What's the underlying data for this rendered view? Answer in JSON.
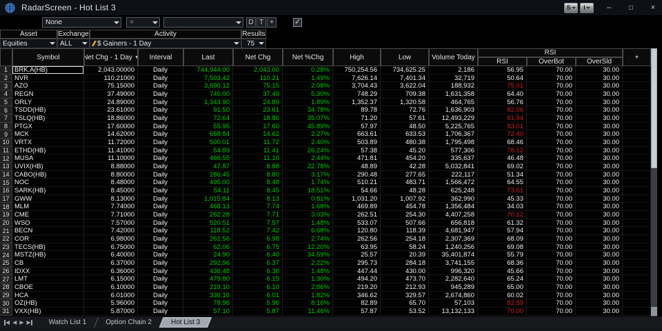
{
  "window": {
    "title": "RadarScreen - Hot List 3",
    "style_button": "S",
    "insert_button": "I",
    "minimize": "–",
    "maximize": "□",
    "close": "×"
  },
  "icons": {
    "check": "✓",
    "sort_desc": "▼",
    "nav_prev": "◀",
    "nav_next": "▶",
    "globe": "globe-icon",
    "dropdown_arrow": "triangle-down",
    "activity_flag": "yellow-flash"
  },
  "filter_bar": {
    "field_value": "None",
    "operator_value": "=",
    "criteria_value": "",
    "buttons": {
      "d": "D",
      "t": "T",
      "plus": "+"
    },
    "checkbox_checked": true
  },
  "criteria_bar": {
    "headers": {
      "asset": "Asset",
      "exchange": "Exchange",
      "activity": "Activity",
      "results": "Results"
    },
    "asset_value": "Equities",
    "exchange_value": "ALL",
    "activity_value": "$ Gainers -  1 Day",
    "results_value": "75"
  },
  "table": {
    "group_header": "RSI",
    "plus_header": "+",
    "columns": [
      "Symbol",
      "Net Chg - 1 Day",
      "Interval",
      "Last",
      "Net Chg",
      "Net %Chg",
      "High",
      "Low",
      "Volume Today",
      "RSI",
      "OverBot",
      "OverSld"
    ],
    "sort_column": "Net Chg - 1 Day",
    "rows": [
      {
        "num": "1",
        "symbol": "BRK.A(HB)",
        "net_chg_1day": "2,043.00000",
        "interval": "Daily",
        "last": "744,944.00",
        "net_chg": "2,043.00",
        "net_pct_chg": "0.28%",
        "high": "750,254.56",
        "low": "734,625.25",
        "volume": "2,186",
        "rsi": "56.95",
        "overbot": "70.00",
        "oversld": "30.00",
        "rsi_alert": false
      },
      {
        "num": "2",
        "symbol": "NVR",
        "net_chg_1day": "110.21000",
        "interval": "Daily",
        "last": "7,503.42",
        "net_chg": "110.21",
        "net_pct_chg": "1.49%",
        "high": "7,626.14",
        "low": "7,401.34",
        "volume": "32,719",
        "rsi": "50.64",
        "overbot": "70.00",
        "oversld": "30.00",
        "rsi_alert": false
      },
      {
        "num": "3",
        "symbol": "AZO",
        "net_chg_1day": "75.15000",
        "interval": "Daily",
        "last": "3,690.12",
        "net_chg": "75.15",
        "net_pct_chg": "2.08%",
        "high": "3,704.43",
        "low": "3,622.04",
        "volume": "188,932",
        "rsi": "75.01",
        "overbot": "70.00",
        "oversld": "30.00",
        "rsi_alert": true
      },
      {
        "num": "4",
        "symbol": "REGN",
        "net_chg_1day": "37.49000",
        "interval": "Daily",
        "last": "745.00",
        "net_chg": "37.49",
        "net_pct_chg": "5.30%",
        "high": "748.29",
        "low": "709.38",
        "volume": "1,631,358",
        "rsi": "64.40",
        "overbot": "70.00",
        "oversld": "30.00",
        "rsi_alert": false
      },
      {
        "num": "5",
        "symbol": "ORLY",
        "net_chg_1day": "24.89000",
        "interval": "Daily",
        "last": "1,343.90",
        "net_chg": "24.89",
        "net_pct_chg": "1.89%",
        "high": "1,352.37",
        "low": "1,320.58",
        "volume": "464,765",
        "rsi": "56.76",
        "overbot": "70.00",
        "oversld": "30.00",
        "rsi_alert": false
      },
      {
        "num": "6",
        "symbol": "TSDD(HB)",
        "net_chg_1day": "23.61000",
        "interval": "Daily",
        "last": "91.50",
        "net_chg": "23.61",
        "net_pct_chg": "34.78%",
        "high": "89.78",
        "low": "72.76",
        "volume": "1,636,903",
        "rsi": "82.06",
        "overbot": "70.00",
        "oversld": "30.00",
        "rsi_alert": true
      },
      {
        "num": "7",
        "symbol": "TSLQ(HB)",
        "net_chg_1day": "18.86000",
        "interval": "Daily",
        "last": "72.64",
        "net_chg": "18.86",
        "net_pct_chg": "35.07%",
        "high": "71.20",
        "low": "57.61",
        "volume": "12,493,229",
        "rsi": "81.94",
        "overbot": "70.00",
        "oversld": "30.00",
        "rsi_alert": true
      },
      {
        "num": "8",
        "symbol": "PTGX",
        "net_chg_1day": "17.60000",
        "interval": "Daily",
        "last": "55.95",
        "net_chg": "17.60",
        "net_pct_chg": "45.89%",
        "high": "57.97",
        "low": "48.50",
        "volume": "5,225,765",
        "rsi": "83.01",
        "overbot": "70.00",
        "oversld": "30.00",
        "rsi_alert": true
      },
      {
        "num": "9",
        "symbol": "MCK",
        "net_chg_1day": "14.62000",
        "interval": "Daily",
        "last": "658.84",
        "net_chg": "14.62",
        "net_pct_chg": "2.27%",
        "high": "663.61",
        "low": "633.53",
        "volume": "1,706,367",
        "rsi": "72.40",
        "overbot": "70.00",
        "oversld": "30.00",
        "rsi_alert": true
      },
      {
        "num": "10",
        "symbol": "VRTX",
        "net_chg_1day": "11.72000",
        "interval": "Daily",
        "last": "500.01",
        "net_chg": "11.72",
        "net_pct_chg": "2.40%",
        "high": "503.89",
        "low": "480.38",
        "volume": "1,795,498",
        "rsi": "68.46",
        "overbot": "70.00",
        "oversld": "30.00",
        "rsi_alert": false
      },
      {
        "num": "11",
        "symbol": "ETHD(HB)",
        "net_chg_1day": "11.41000",
        "interval": "Daily",
        "last": "54.89",
        "net_chg": "11.41",
        "net_pct_chg": "26.24%",
        "high": "57.38",
        "low": "45.20",
        "volume": "577,306",
        "rsi": "78.12",
        "overbot": "70.00",
        "oversld": "30.00",
        "rsi_alert": true
      },
      {
        "num": "12",
        "symbol": "MUSA",
        "net_chg_1day": "11.10000",
        "interval": "Daily",
        "last": "466.55",
        "net_chg": "11.10",
        "net_pct_chg": "2.44%",
        "high": "471.81",
        "low": "454.20",
        "volume": "335,637",
        "rsi": "46.48",
        "overbot": "70.00",
        "oversld": "30.00",
        "rsi_alert": false
      },
      {
        "num": "13",
        "symbol": "UVIX(HB)",
        "net_chg_1day": "8.88000",
        "interval": "Daily",
        "last": "47.87",
        "net_chg": "8.88",
        "net_pct_chg": "22.78%",
        "high": "48.89",
        "low": "42.28",
        "volume": "5,032,841",
        "rsi": "69.02",
        "overbot": "70.00",
        "oversld": "30.00",
        "rsi_alert": false
      },
      {
        "num": "14",
        "symbol": "CABO(HB)",
        "net_chg_1day": "8.80000",
        "interval": "Daily",
        "last": "286.45",
        "net_chg": "8.80",
        "net_pct_chg": "3.17%",
        "high": "290.48",
        "low": "277.65",
        "volume": "222,117",
        "rsi": "51.34",
        "overbot": "70.00",
        "oversld": "30.00",
        "rsi_alert": false
      },
      {
        "num": "15",
        "symbol": "NOC",
        "net_chg_1day": "8.48000",
        "interval": "Daily",
        "last": "495.00",
        "net_chg": "8.48",
        "net_pct_chg": "1.74%",
        "high": "510.21",
        "low": "483.71",
        "volume": "1,566,472",
        "rsi": "64.55",
        "overbot": "70.00",
        "oversld": "30.00",
        "rsi_alert": false
      },
      {
        "num": "16",
        "symbol": "SARK(HB)",
        "net_chg_1day": "8.45000",
        "interval": "Daily",
        "last": "54.11",
        "net_chg": "8.45",
        "net_pct_chg": "18.51%",
        "high": "54.66",
        "low": "48.28",
        "volume": "625,248",
        "rsi": "73.61",
        "overbot": "70.00",
        "oversld": "30.00",
        "rsi_alert": true
      },
      {
        "num": "17",
        "symbol": "GWW",
        "net_chg_1day": "8.13000",
        "interval": "Daily",
        "last": "1,015.84",
        "net_chg": "8.13",
        "net_pct_chg": "0.81%",
        "high": "1,031.20",
        "low": "1,007.92",
        "volume": "362,990",
        "rsi": "45.33",
        "overbot": "70.00",
        "oversld": "30.00",
        "rsi_alert": false
      },
      {
        "num": "18",
        "symbol": "MLM",
        "net_chg_1day": "7.74000",
        "interval": "Daily",
        "last": "468.13",
        "net_chg": "7.74",
        "net_pct_chg": "1.68%",
        "high": "469.89",
        "low": "454.78",
        "volume": "1,356,484",
        "rsi": "34.03",
        "overbot": "70.00",
        "oversld": "30.00",
        "rsi_alert": false
      },
      {
        "num": "19",
        "symbol": "CME",
        "net_chg_1day": "7.71000",
        "interval": "Daily",
        "last": "262.28",
        "net_chg": "7.71",
        "net_pct_chg": "3.03%",
        "high": "262.51",
        "low": "254.30",
        "volume": "4,407,258",
        "rsi": "70.12",
        "overbot": "70.00",
        "oversld": "30.00",
        "rsi_alert": true
      },
      {
        "num": "20",
        "symbol": "WSO",
        "net_chg_1day": "7.57000",
        "interval": "Daily",
        "last": "520.51",
        "net_chg": "7.57",
        "net_pct_chg": "1.48%",
        "high": "533.07",
        "low": "507.66",
        "volume": "656,818",
        "rsi": "61.32",
        "overbot": "70.00",
        "oversld": "30.00",
        "rsi_alert": false
      },
      {
        "num": "21",
        "symbol": "BECN",
        "net_chg_1day": "7.42000",
        "interval": "Daily",
        "last": "118.52",
        "net_chg": "7.42",
        "net_pct_chg": "6.68%",
        "high": "120.80",
        "low": "118.39",
        "volume": "4,681,947",
        "rsi": "57.94",
        "overbot": "70.00",
        "oversld": "30.00",
        "rsi_alert": false
      },
      {
        "num": "22",
        "symbol": "COR",
        "net_chg_1day": "6.98000",
        "interval": "Daily",
        "last": "261.56",
        "net_chg": "6.98",
        "net_pct_chg": "2.74%",
        "high": "262.56",
        "low": "254.18",
        "volume": "2,307,369",
        "rsi": "68.09",
        "overbot": "70.00",
        "oversld": "30.00",
        "rsi_alert": false
      },
      {
        "num": "23",
        "symbol": "TECS(HB)",
        "net_chg_1day": "6.75000",
        "interval": "Daily",
        "last": "62.06",
        "net_chg": "6.75",
        "net_pct_chg": "12.20%",
        "high": "63.95",
        "low": "58.24",
        "volume": "1,240,256",
        "rsi": "69.08",
        "overbot": "70.00",
        "oversld": "30.00",
        "rsi_alert": false
      },
      {
        "num": "24",
        "symbol": "MSTZ(HB)",
        "net_chg_1day": "6.40000",
        "interval": "Daily",
        "last": "24.90",
        "net_chg": "6.40",
        "net_pct_chg": "34.59%",
        "high": "25.57",
        "low": "20.39",
        "volume": "35,401,874",
        "rsi": "55.79",
        "overbot": "70.00",
        "oversld": "30.00",
        "rsi_alert": false
      },
      {
        "num": "25",
        "symbol": "CB",
        "net_chg_1day": "6.37000",
        "interval": "Daily",
        "last": "292.96",
        "net_chg": "6.37",
        "net_pct_chg": "2.22%",
        "high": "295.73",
        "low": "284.18",
        "volume": "3,741,155",
        "rsi": "68.36",
        "overbot": "70.00",
        "oversld": "30.00",
        "rsi_alert": false
      },
      {
        "num": "26",
        "symbol": "IDXX",
        "net_chg_1day": "6.36000",
        "interval": "Daily",
        "last": "436.48",
        "net_chg": "6.36",
        "net_pct_chg": "1.48%",
        "high": "447.44",
        "low": "430.00",
        "volume": "996,320",
        "rsi": "45.66",
        "overbot": "70.00",
        "oversld": "30.00",
        "rsi_alert": false
      },
      {
        "num": "27",
        "symbol": "LMT",
        "net_chg_1day": "6.15000",
        "interval": "Daily",
        "last": "479.80",
        "net_chg": "6.15",
        "net_pct_chg": "1.30%",
        "high": "494.20",
        "low": "473.70",
        "volume": "2,282,640",
        "rsi": "65.24",
        "overbot": "70.00",
        "oversld": "30.00",
        "rsi_alert": false
      },
      {
        "num": "28",
        "symbol": "CBOE",
        "net_chg_1day": "6.10000",
        "interval": "Daily",
        "last": "219.10",
        "net_chg": "6.10",
        "net_pct_chg": "2.86%",
        "high": "219.20",
        "low": "212.93",
        "volume": "945,289",
        "rsi": "65.00",
        "overbot": "70.00",
        "oversld": "30.00",
        "rsi_alert": false
      },
      {
        "num": "29",
        "symbol": "HCA",
        "net_chg_1day": "6.01000",
        "interval": "Daily",
        "last": "336.16",
        "net_chg": "6.01",
        "net_pct_chg": "1.82%",
        "high": "346.62",
        "low": "329.57",
        "volume": "2,674,860",
        "rsi": "60.02",
        "overbot": "70.00",
        "oversld": "30.00",
        "rsi_alert": false
      },
      {
        "num": "30",
        "symbol": "OZ(HB)",
        "net_chg_1day": "5.96000",
        "interval": "Daily",
        "last": "78.96",
        "net_chg": "5.96",
        "net_pct_chg": "8.16%",
        "high": "82.89",
        "low": "65.70",
        "volume": "57,103",
        "rsi": "82.59",
        "overbot": "70.00",
        "oversld": "30.00",
        "rsi_alert": true
      },
      {
        "num": "31",
        "symbol": "VXX(HB)",
        "net_chg_1day": "5.87000",
        "interval": "Daily",
        "last": "57.10",
        "net_chg": "5.87",
        "net_pct_chg": "11.46%",
        "high": "57.87",
        "low": "53.52",
        "volume": "13,132,133",
        "rsi": "70.00",
        "overbot": "70.00",
        "oversld": "30.00",
        "rsi_alert": true
      }
    ]
  },
  "tabs": {
    "items": [
      {
        "label": "Watch List 1",
        "active": false
      },
      {
        "label": "Option Chain 2",
        "active": false
      },
      {
        "label": "Hot List 3",
        "active": true
      }
    ]
  },
  "colors": {
    "positive_green": "#00cc00",
    "alert_red": "#cc2020",
    "titlebar_bg": "#0d1117",
    "active_tab_bg": "#a3a9b1"
  }
}
